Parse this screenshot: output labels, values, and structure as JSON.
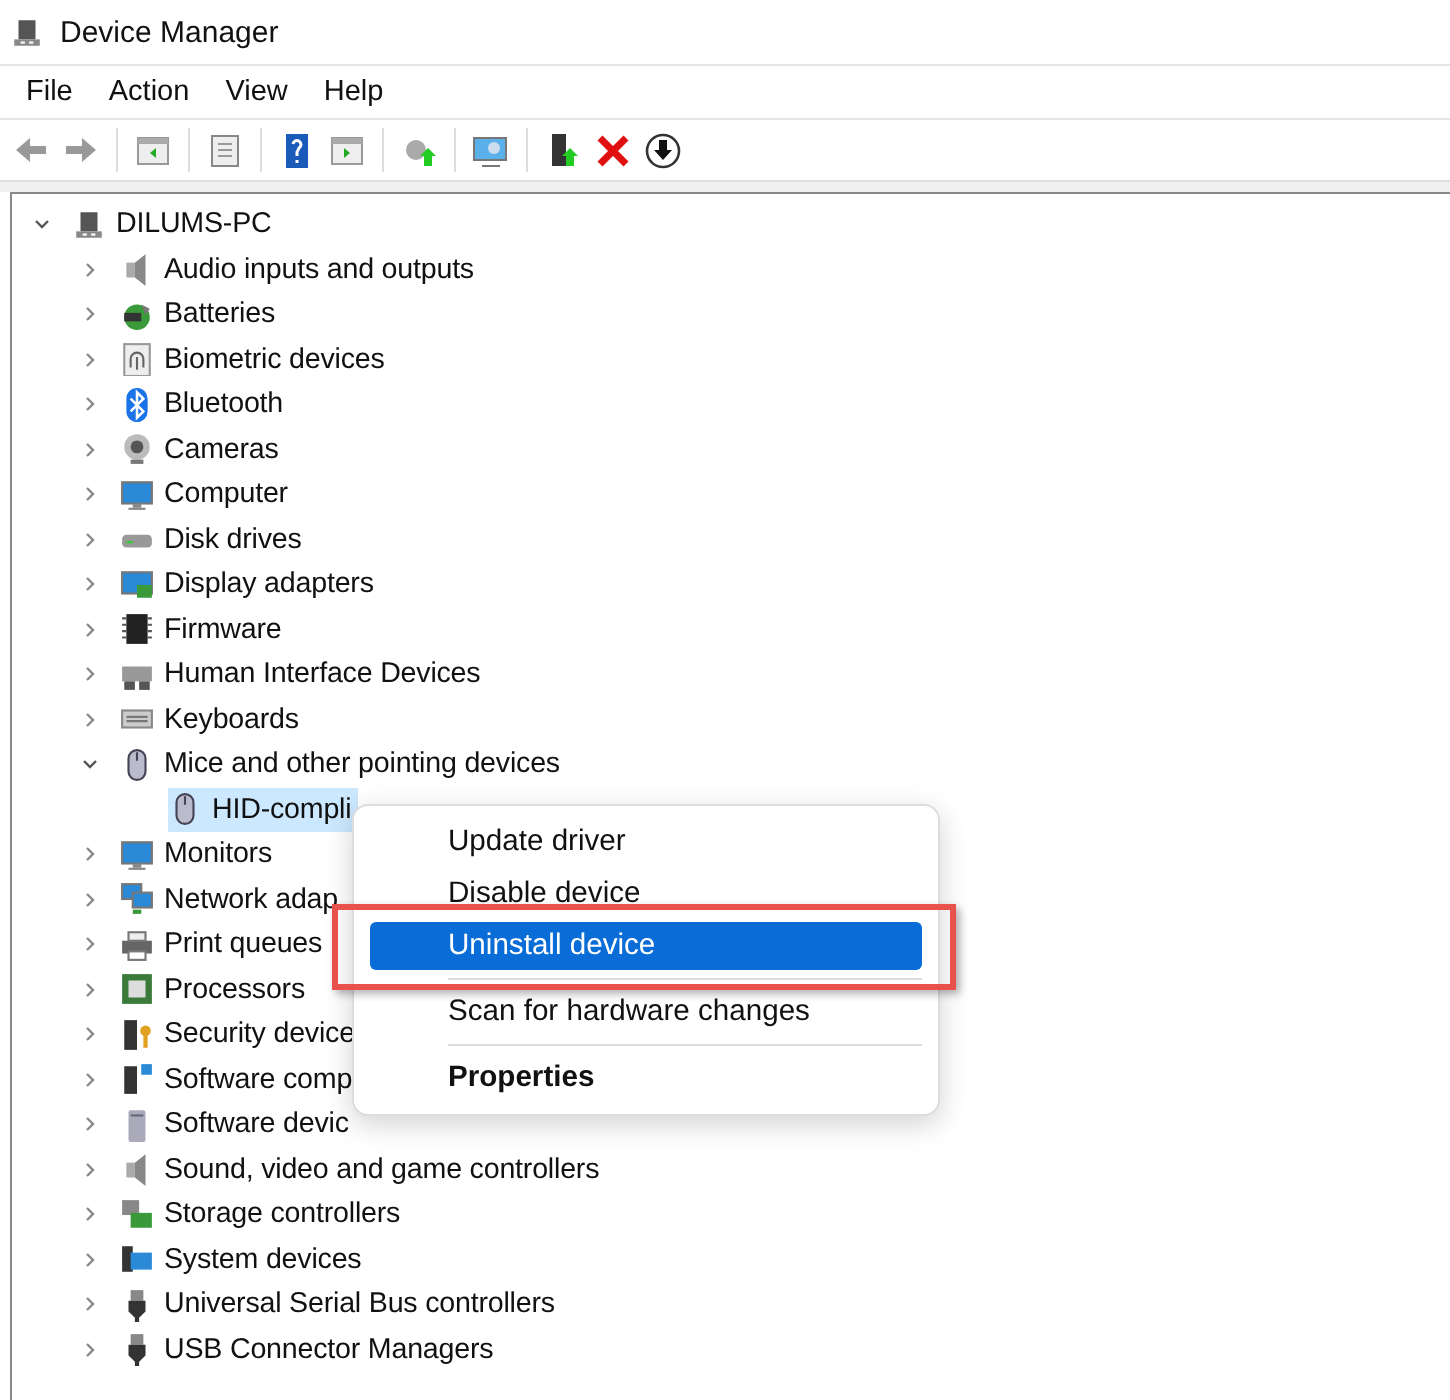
{
  "window": {
    "title": "Device Manager"
  },
  "menu_bar": [
    "File",
    "Action",
    "View",
    "Help"
  ],
  "tree": [
    {
      "label": "DILUMS-PC",
      "expanded": true,
      "selected": false,
      "children": [
        {
          "label": "Audio inputs and outputs",
          "expanded": false,
          "selected": false
        },
        {
          "label": "Batteries",
          "expanded": false,
          "selected": false
        },
        {
          "label": "Biometric devices",
          "expanded": false,
          "selected": false
        },
        {
          "label": "Bluetooth",
          "expanded": false,
          "selected": false
        },
        {
          "label": "Cameras",
          "expanded": false,
          "selected": false
        },
        {
          "label": "Computer",
          "expanded": false,
          "selected": false
        },
        {
          "label": "Disk drives",
          "expanded": false,
          "selected": false
        },
        {
          "label": "Display adapters",
          "expanded": false,
          "selected": false
        },
        {
          "label": "Firmware",
          "expanded": false,
          "selected": false
        },
        {
          "label": "Human Interface Devices",
          "expanded": false,
          "selected": false
        },
        {
          "label": "Keyboards",
          "expanded": false,
          "selected": false
        },
        {
          "label": "Mice and other pointing devices",
          "expanded": true,
          "selected": false,
          "children": [
            {
              "label": "HID-compli",
              "selected": true
            }
          ]
        },
        {
          "label": "Monitors",
          "expanded": false,
          "selected": false
        },
        {
          "label": "Network adap",
          "expanded": false,
          "selected": false
        },
        {
          "label": "Print queues",
          "expanded": false,
          "selected": false
        },
        {
          "label": "Processors",
          "expanded": false,
          "selected": false
        },
        {
          "label": "Security device",
          "expanded": false,
          "selected": false
        },
        {
          "label": "Software comp",
          "expanded": false,
          "selected": false
        },
        {
          "label": "Software devic",
          "expanded": false,
          "selected": false
        },
        {
          "label": "Sound, video and game controllers",
          "expanded": false,
          "selected": false
        },
        {
          "label": "Storage controllers",
          "expanded": false,
          "selected": false
        },
        {
          "label": "System devices",
          "expanded": false,
          "selected": false
        },
        {
          "label": "Universal Serial Bus controllers",
          "expanded": false,
          "selected": false
        },
        {
          "label": "USB Connector Managers",
          "expanded": false,
          "selected": false
        }
      ]
    }
  ],
  "context_menu": {
    "items": [
      {
        "kind": "item",
        "label": "Update driver",
        "selected": false
      },
      {
        "kind": "item",
        "label": "Disable device",
        "selected": false
      },
      {
        "kind": "item",
        "label": "Uninstall device",
        "selected": true
      },
      {
        "kind": "separator"
      },
      {
        "kind": "item",
        "label": "Scan for hardware changes",
        "selected": false
      },
      {
        "kind": "separator"
      },
      {
        "kind": "default",
        "label": "Properties",
        "selected": false
      }
    ]
  }
}
